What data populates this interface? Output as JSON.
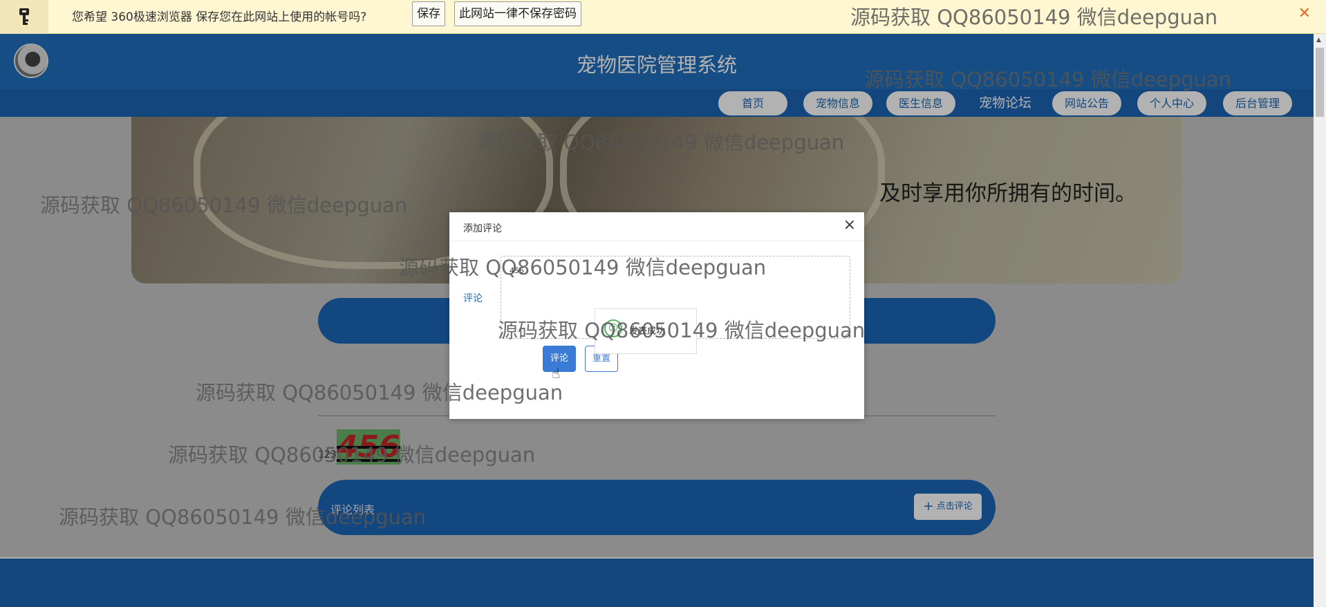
{
  "browser_bar": {
    "message": "您希望 360极速浏览器 保存您在此网站上使用的帐号吗?",
    "save_label": "保存",
    "never_label": "此网站一律不保存密码",
    "close_glyph": "✕"
  },
  "header": {
    "title": "宠物医院管理系统"
  },
  "nav": {
    "items": [
      {
        "label": "首页"
      },
      {
        "label": "宠物信息"
      },
      {
        "label": "医生信息"
      },
      {
        "label": "宠物论坛"
      },
      {
        "label": "网站公告"
      },
      {
        "label": "个人中心"
      },
      {
        "label": "后台管理"
      }
    ],
    "active": "宠物论坛"
  },
  "banner": {
    "quote": "及时享用你所拥有的时间。"
  },
  "post": {
    "text": "123",
    "highlight": "456"
  },
  "comments": {
    "title": "评论列表",
    "add_label": "点击评论",
    "add_icon": "plus-icon"
  },
  "dialog": {
    "title": "添加评论",
    "field_label": "评论",
    "comment_value": "456",
    "submit_label": "评论",
    "reset_label": "重置",
    "toast_text": "发表成功",
    "close_glyph": "×"
  },
  "watermark": {
    "text": "源码获取 QQ86050149 微信deepguan"
  },
  "colors": {
    "primary": "#1f6fbd",
    "nav": "#1b65b4",
    "button": "#3a7bd5",
    "success": "#52b55e",
    "bar_bg": "#fff7d2"
  }
}
